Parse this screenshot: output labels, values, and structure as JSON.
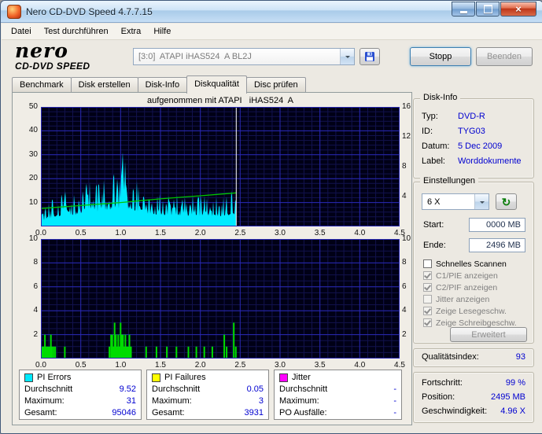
{
  "window": {
    "title": "Nero CD-DVD Speed 4.7.7.15"
  },
  "menu": {
    "items": [
      "Datei",
      "Test durchführen",
      "Extra",
      "Hilfe"
    ]
  },
  "header": {
    "logo_line1": "nero",
    "logo_line2": "CD-DVD SPEED",
    "drive_selector": "[3:0]  ATAPI iHAS524  A BL2J",
    "stop_button": "Stopp",
    "quit_button": "Beenden"
  },
  "tabs": {
    "items": [
      "Benchmark",
      "Disk erstellen",
      "Disk-Info",
      "Diskqualität",
      "Disc prüfen"
    ],
    "active": "Diskqualität"
  },
  "chart_data": [
    {
      "type": "area",
      "series": "PI Errors",
      "title": "aufgenommen mit ATAPI   iHAS524  A",
      "x_unit": "GB",
      "xlim": [
        0,
        4.5
      ],
      "x_ticks": [
        "0.0",
        "0.5",
        "1.0",
        "1.5",
        "2.0",
        "2.5",
        "3.0",
        "3.5",
        "4.0",
        "4.5"
      ],
      "ylim": [
        0,
        50
      ],
      "y_ticks_left": [
        50,
        40,
        30,
        20,
        10
      ],
      "ylim_right": [
        0,
        16
      ],
      "y_ticks_right": [
        16,
        12,
        8,
        4
      ],
      "grid": true,
      "data_end_x": 2.45,
      "cursor_x": 2.45,
      "avg": 9.52,
      "max": 31,
      "total": 95046,
      "peak": [
        1.03,
        31
      ],
      "envelope": [
        [
          0,
          7
        ],
        [
          0.1,
          10
        ],
        [
          0.2,
          13
        ],
        [
          0.3,
          15
        ],
        [
          0.4,
          14
        ],
        [
          0.5,
          17
        ],
        [
          0.6,
          19
        ],
        [
          0.7,
          18
        ],
        [
          0.8,
          21
        ],
        [
          0.9,
          22
        ],
        [
          1.0,
          24
        ],
        [
          1.03,
          31
        ],
        [
          1.1,
          22
        ],
        [
          1.2,
          20
        ],
        [
          1.3,
          17
        ],
        [
          1.4,
          16
        ],
        [
          1.5,
          15
        ],
        [
          1.6,
          14
        ],
        [
          1.7,
          15
        ],
        [
          1.8,
          13
        ],
        [
          1.9,
          14
        ],
        [
          2.0,
          13
        ],
        [
          2.1,
          14
        ],
        [
          2.2,
          13
        ],
        [
          2.3,
          14
        ],
        [
          2.4,
          15
        ],
        [
          2.45,
          13
        ]
      ],
      "speed_line_x_units": [
        [
          0,
          2.4
        ],
        [
          0.5,
          2.8
        ],
        [
          1.0,
          3.2
        ],
        [
          1.5,
          3.7
        ],
        [
          2.0,
          4.1
        ],
        [
          2.45,
          4.5
        ]
      ],
      "colors": {
        "fill": "#00eaff",
        "speed": "#00c800",
        "bg": "#000016",
        "grid_major": "#2929b4",
        "grid_minor": "#12124e",
        "cursor": "#ffffff"
      }
    },
    {
      "type": "bar",
      "series": "PI Failures",
      "x_unit": "GB",
      "xlim": [
        0,
        4.5
      ],
      "x_ticks": [
        "0.0",
        "0.5",
        "1.0",
        "1.5",
        "2.0",
        "2.5",
        "3.0",
        "3.5",
        "4.0",
        "4.5"
      ],
      "ylim": [
        0,
        10
      ],
      "y_ticks_left": [
        10,
        8,
        6,
        4,
        2
      ],
      "y_ticks_right": [
        10,
        8,
        6,
        4,
        2
      ],
      "grid": true,
      "data_end_x": 2.45,
      "avg": 0.05,
      "max": 3,
      "total": 3931,
      "bars": [
        [
          0.02,
          1
        ],
        [
          0.035,
          1
        ],
        [
          0.05,
          2
        ],
        [
          0.065,
          1
        ],
        [
          0.08,
          1
        ],
        [
          0.095,
          1
        ],
        [
          0.11,
          1
        ],
        [
          0.125,
          2
        ],
        [
          0.14,
          1
        ],
        [
          0.16,
          1
        ],
        [
          0.18,
          1
        ],
        [
          0.3,
          1
        ],
        [
          0.86,
          1
        ],
        [
          0.88,
          2
        ],
        [
          0.895,
          2
        ],
        [
          0.91,
          1
        ],
        [
          0.925,
          3
        ],
        [
          0.94,
          2
        ],
        [
          0.955,
          1
        ],
        [
          0.97,
          2
        ],
        [
          0.985,
          1
        ],
        [
          1.0,
          3
        ],
        [
          1.015,
          2
        ],
        [
          1.03,
          2
        ],
        [
          1.045,
          1
        ],
        [
          1.06,
          2
        ],
        [
          1.075,
          1
        ],
        [
          1.09,
          1
        ],
        [
          1.11,
          2
        ],
        [
          1.13,
          1
        ],
        [
          1.32,
          1
        ],
        [
          1.45,
          1
        ],
        [
          1.58,
          1
        ],
        [
          1.7,
          1
        ],
        [
          1.85,
          1
        ],
        [
          1.95,
          1
        ],
        [
          2.05,
          1
        ],
        [
          2.15,
          1
        ],
        [
          2.3,
          2
        ],
        [
          2.33,
          1
        ],
        [
          2.42,
          3
        ],
        [
          2.445,
          1
        ]
      ],
      "colors": {
        "bar": "#00dd00",
        "bg": "#000016",
        "grid_major": "#2929b4",
        "grid_minor": "#12124e"
      }
    }
  ],
  "disk_info": {
    "title": "Disk-Info",
    "rows": [
      {
        "label": "Typ:",
        "value": "DVD-R"
      },
      {
        "label": "ID:",
        "value": "TYG03"
      },
      {
        "label": "Datum:",
        "value": "5 Dec 2009"
      },
      {
        "label": "Label:",
        "value": "Worddokumente"
      }
    ]
  },
  "settings": {
    "title": "Einstellungen",
    "speed_select": "6 X",
    "refresh_icon": "↻",
    "start_label": "Start:",
    "start_value": "0000 MB",
    "end_label": "Ende:",
    "end_value": "2496 MB",
    "checkboxes": [
      {
        "label": "Schnelles Scannen",
        "checked": false,
        "disabled": false
      },
      {
        "label": "C1/PIE anzeigen",
        "checked": true,
        "disabled": true
      },
      {
        "label": "C2/PIF anzeigen",
        "checked": true,
        "disabled": true
      },
      {
        "label": "Jitter anzeigen",
        "checked": false,
        "disabled": true
      },
      {
        "label": "Zeige Lesegeschw.",
        "checked": true,
        "disabled": true
      },
      {
        "label": "Zeige Schreibgeschw.",
        "checked": true,
        "disabled": true
      }
    ],
    "advanced_button": "Erweitert"
  },
  "quality": {
    "label": "Qualitätsindex:",
    "value": "93"
  },
  "progress": {
    "rows": [
      {
        "label": "Fortschritt:",
        "value": "99 %"
      },
      {
        "label": "Position:",
        "value": "2495 MB"
      },
      {
        "label": "Geschwindigkeit:",
        "value": "4.96 X"
      }
    ]
  },
  "stats": [
    {
      "title": "PI Errors",
      "color": "#00eaff",
      "rows": [
        {
          "label": "Durchschnitt",
          "value": "9.52"
        },
        {
          "label": "Maximum:",
          "value": "31"
        },
        {
          "label": "Gesamt:",
          "value": "95046"
        }
      ]
    },
    {
      "title": "PI Failures",
      "color": "#ffff00",
      "rows": [
        {
          "label": "Durchschnitt",
          "value": "0.05"
        },
        {
          "label": "Maximum:",
          "value": "3"
        },
        {
          "label": "Gesamt:",
          "value": "3931"
        }
      ]
    },
    {
      "title": "Jitter",
      "color": "#ff00ff",
      "rows": [
        {
          "label": "Durchschnitt",
          "value": "-"
        },
        {
          "label": "Maximum:",
          "value": "-"
        },
        {
          "label": "PO Ausfälle:",
          "value": "-"
        }
      ]
    }
  ],
  "ui_colors": {
    "value_text": "#0000d0",
    "titlebar_close": "#bd3517",
    "chart_fill": "#00eaff",
    "chart_bars": "#00dd00"
  }
}
